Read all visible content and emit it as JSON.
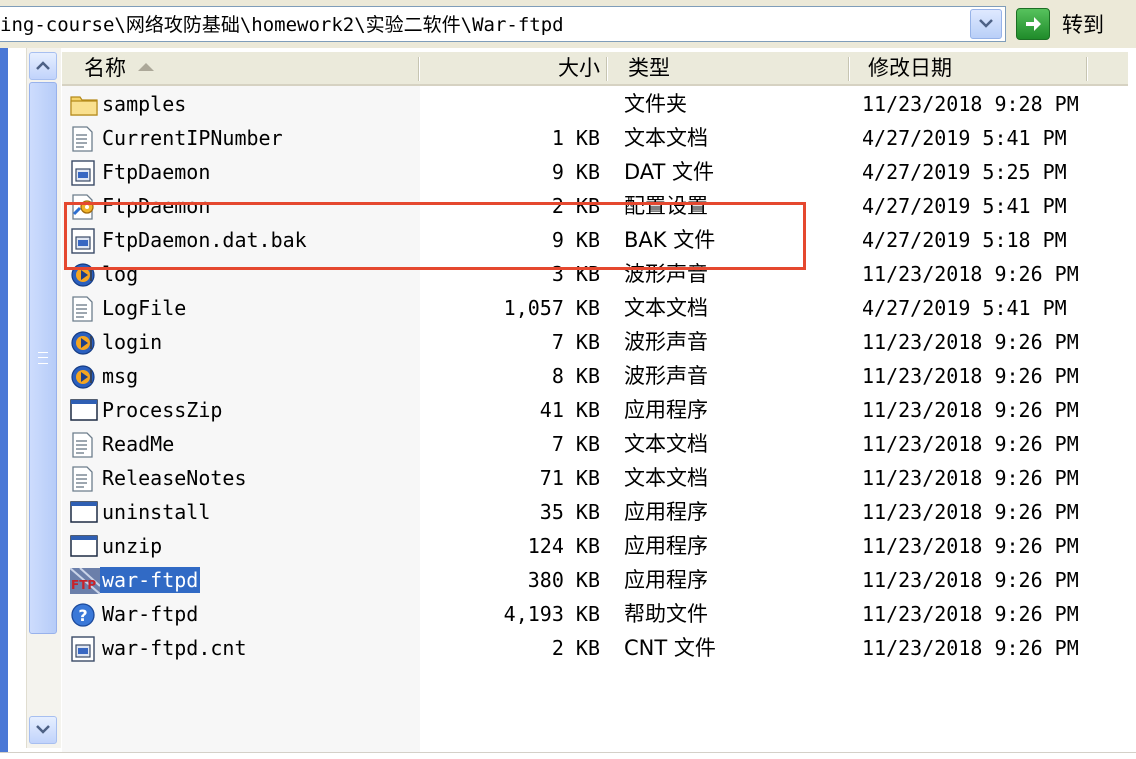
{
  "address": {
    "path": "ing-course\\网络攻防基础\\homework2\\实验二软件\\War-ftpd",
    "go_label": "转到"
  },
  "columns": {
    "name": "名称",
    "size": "大小",
    "type": "类型",
    "date": "修改日期"
  },
  "files": [
    {
      "name": "samples",
      "size": "",
      "type": "文件夹",
      "date": "11/23/2018 9:28 PM",
      "icon": "folder-icon"
    },
    {
      "name": "CurrentIPNumber",
      "size": "1 KB",
      "type": "文本文档",
      "date": "4/27/2019 5:41 PM",
      "icon": "text-file-icon"
    },
    {
      "name": "FtpDaemon",
      "size": "9 KB",
      "type": "DAT 文件",
      "date": "4/27/2019 5:25 PM",
      "icon": "generic-file-icon"
    },
    {
      "name": "FtpDaemon",
      "size": "2 KB",
      "type": "配置设置",
      "date": "4/27/2019 5:41 PM",
      "icon": "config-file-icon"
    },
    {
      "name": "FtpDaemon.dat.bak",
      "size": "9 KB",
      "type": "BAK 文件",
      "date": "4/27/2019 5:18 PM",
      "icon": "generic-file-icon"
    },
    {
      "name": "log",
      "size": "3 KB",
      "type": "波形声音",
      "date": "11/23/2018 9:26 PM",
      "icon": "audio-file-icon"
    },
    {
      "name": "LogFile",
      "size": "1,057 KB",
      "type": "文本文档",
      "date": "4/27/2019 5:41 PM",
      "icon": "text-file-icon"
    },
    {
      "name": "login",
      "size": "7 KB",
      "type": "波形声音",
      "date": "11/23/2018 9:26 PM",
      "icon": "audio-file-icon"
    },
    {
      "name": "msg",
      "size": "8 KB",
      "type": "波形声音",
      "date": "11/23/2018 9:26 PM",
      "icon": "audio-file-icon"
    },
    {
      "name": "ProcessZip",
      "size": "41 KB",
      "type": "应用程序",
      "date": "11/23/2018 9:26 PM",
      "icon": "application-icon"
    },
    {
      "name": "ReadMe",
      "size": "7 KB",
      "type": "文本文档",
      "date": "11/23/2018 9:26 PM",
      "icon": "text-file-icon"
    },
    {
      "name": "ReleaseNotes",
      "size": "71 KB",
      "type": "文本文档",
      "date": "11/23/2018 9:26 PM",
      "icon": "text-file-icon"
    },
    {
      "name": "uninstall",
      "size": "35 KB",
      "type": "应用程序",
      "date": "11/23/2018 9:26 PM",
      "icon": "application-icon"
    },
    {
      "name": "unzip",
      "size": "124 KB",
      "type": "应用程序",
      "date": "11/23/2018 9:26 PM",
      "icon": "application-icon"
    },
    {
      "name": "war-ftpd",
      "size": "380 KB",
      "type": "应用程序",
      "date": "11/23/2018 9:26 PM",
      "icon": "ftp-app-icon",
      "icon_text": "FTP",
      "selected": true
    },
    {
      "name": "War-ftpd",
      "size": "4,193 KB",
      "type": "帮助文件",
      "date": "11/23/2018 9:26 PM",
      "icon": "help-file-icon"
    },
    {
      "name": "war-ftpd.cnt",
      "size": "2 KB",
      "type": "CNT 文件",
      "date": "11/23/2018 9:26 PM",
      "icon": "generic-file-icon"
    }
  ],
  "colors": {
    "selection": "#316ac5",
    "highlight_box": "#e5482f"
  }
}
